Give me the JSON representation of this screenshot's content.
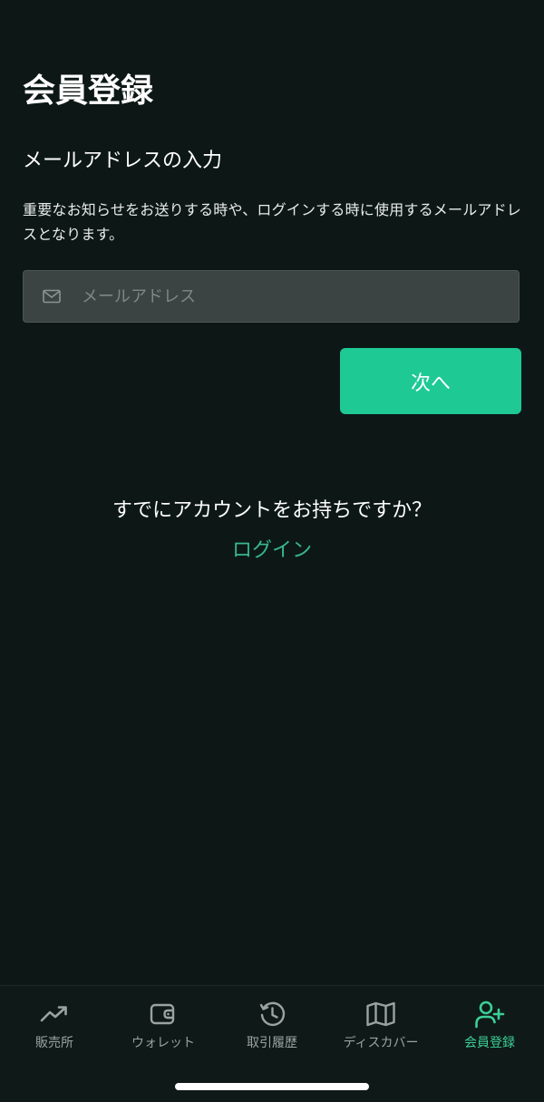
{
  "header": {
    "title": "会員登録"
  },
  "form": {
    "section_title": "メールアドレスの入力",
    "description": "重要なお知らせをお送りする時や、ログインする時に使用するメールアドレスとなります。",
    "email_placeholder": "メールアドレス",
    "email_value": "",
    "email_icon": "mail-icon",
    "next_label": "次へ"
  },
  "login": {
    "prompt": "すでにアカウントをお持ちですか？",
    "link_label": "ログイン"
  },
  "bottom_nav": {
    "active_color": "#3ccf97",
    "inactive_color": "#9aa3a1",
    "items": [
      {
        "label": "販売所",
        "icon": "trending-up-icon"
      },
      {
        "label": "ウォレット",
        "icon": "wallet-icon"
      },
      {
        "label": "取引履歴",
        "icon": "history-icon"
      },
      {
        "label": "ディスカバー",
        "icon": "map-icon"
      },
      {
        "label": "会員登録",
        "icon": "user-plus-icon",
        "active": true
      }
    ]
  },
  "colors": {
    "background": "#0d1816",
    "accent": "#1ec994",
    "link": "#38b98c",
    "input_background": "#3b4442"
  }
}
